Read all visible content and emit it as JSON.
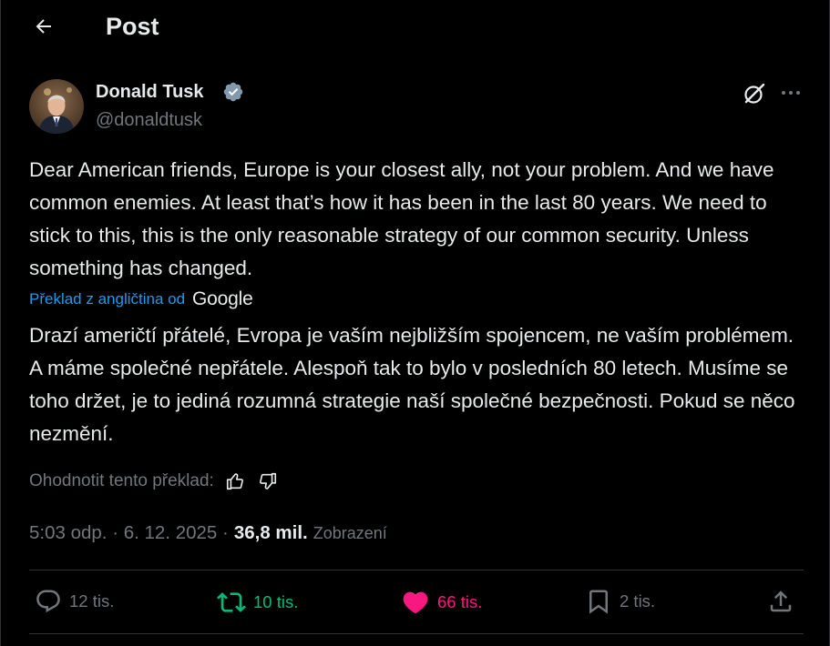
{
  "header": {
    "title": "Post"
  },
  "author": {
    "name": "Donald Tusk",
    "handle": "@donaldtusk"
  },
  "post": {
    "text": "Dear American friends, Europe is your closest ally, not your problem. And we have common enemies. At least that’s how it has been in the last 80 years. We need to stick to this, this is the only reasonable strategy of our common security. Unless something has changed.",
    "translation_link": "Překlad z angličtina od",
    "translation_provider": "Google",
    "translated_text": "Drazí američtí přátelé, Evropa je vaším nejbližším spojencem, ne vaším problémem. A máme společné nepřátele. Alespoň tak to bylo v posledních 80 letech. Musíme se toho držet, je to jediná rozumná strategie naší společné bezpečnosti. Pokud se něco nezmění.",
    "rate_label": "Ohodnotit tento překlad:",
    "timestamp": "5:03 odp. · 6. 12. 2025 ·",
    "views_count": "36,8 mil.",
    "views_label": "Zobrazení"
  },
  "actions": {
    "replies": "12 tis.",
    "reposts": "10 tis.",
    "likes": "66 tis.",
    "bookmarks": "2 tis."
  },
  "colors": {
    "background": "#000000",
    "text": "#e7e9ea",
    "muted": "#71767b",
    "link": "#1d9bf0",
    "repost": "#00ba7c",
    "like": "#f91880",
    "verified": "#829aab"
  }
}
